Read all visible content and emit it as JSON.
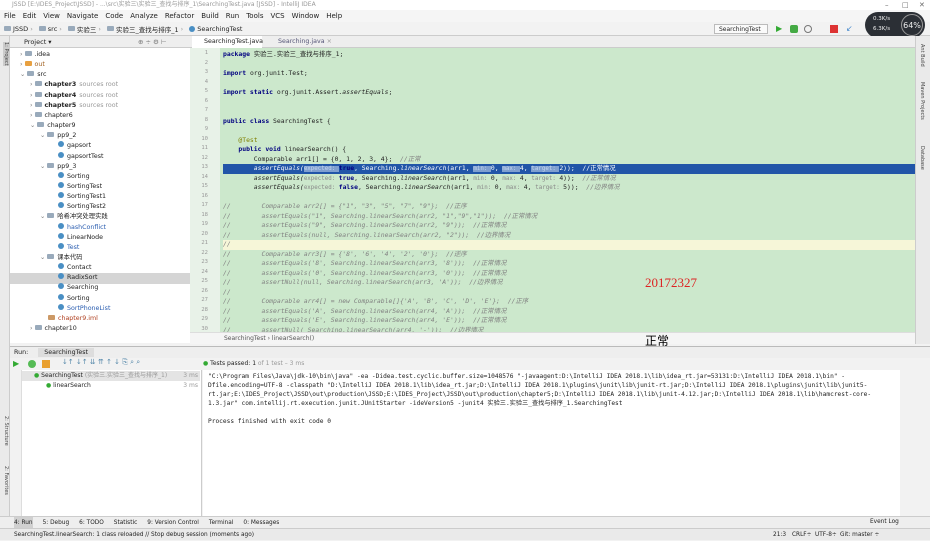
{
  "window": {
    "title": "JSSD [E:\\IDES_Project\\JSSD] - ...\\src\\实验三\\实验三_查找与排序_1\\SearchingTest.java [JSSD] - IntelliJ IDEA"
  },
  "menu": [
    "File",
    "Edit",
    "View",
    "Navigate",
    "Code",
    "Analyze",
    "Refactor",
    "Build",
    "Run",
    "Tools",
    "VCS",
    "Window",
    "Help"
  ],
  "nav": {
    "crumbs": [
      "JSSD",
      "src",
      "实验三",
      "实验三_查找与排序_1",
      "SearchingTest"
    ]
  },
  "toolbar": {
    "run_config": "SearchingTest"
  },
  "perf": {
    "up": "0.3K/s",
    "down": "6.3K/s",
    "percent": "64%"
  },
  "project": {
    "title": "Project ▾",
    "tree": [
      {
        "label": ".idea",
        "depth": 1,
        "kind": "folder",
        "arrow": ">"
      },
      {
        "label": "out",
        "depth": 1,
        "kind": "folder-orange",
        "arrow": ">"
      },
      {
        "label": "src",
        "depth": 1,
        "kind": "folder",
        "arrow": "v"
      },
      {
        "label": "chapter3",
        "depth": 2,
        "kind": "folder",
        "arrow": ">",
        "bold": true,
        "hint": "sources root"
      },
      {
        "label": "chapter4",
        "depth": 2,
        "kind": "folder",
        "arrow": ">",
        "bold": true,
        "hint": "sources root"
      },
      {
        "label": "chapter5",
        "depth": 2,
        "kind": "folder",
        "arrow": ">",
        "bold": true,
        "hint": "sources root"
      },
      {
        "label": "chapter6",
        "depth": 2,
        "kind": "folder",
        "arrow": ">"
      },
      {
        "label": "chapter9",
        "depth": 2,
        "kind": "folder",
        "arrow": "v"
      },
      {
        "label": "pp9_2",
        "depth": 3,
        "kind": "folder",
        "arrow": "v"
      },
      {
        "label": "gapsort",
        "depth": 4,
        "kind": "class"
      },
      {
        "label": "gapsortTest",
        "depth": 4,
        "kind": "class"
      },
      {
        "label": "pp9_3",
        "depth": 3,
        "kind": "folder",
        "arrow": "v"
      },
      {
        "label": "Sorting",
        "depth": 4,
        "kind": "class"
      },
      {
        "label": "SortingTest",
        "depth": 4,
        "kind": "class"
      },
      {
        "label": "SortingTest1",
        "depth": 4,
        "kind": "class"
      },
      {
        "label": "SortingTest2",
        "depth": 4,
        "kind": "class"
      },
      {
        "label": "哈希冲突处理实践",
        "depth": 3,
        "kind": "folder",
        "arrow": "v"
      },
      {
        "label": "hashConflict",
        "depth": 4,
        "kind": "class",
        "blue": true
      },
      {
        "label": "LinearNode",
        "depth": 4,
        "kind": "class"
      },
      {
        "label": "Test",
        "depth": 4,
        "kind": "class",
        "blue": true
      },
      {
        "label": "课本代码",
        "depth": 3,
        "kind": "folder",
        "arrow": "v"
      },
      {
        "label": "Contact",
        "depth": 4,
        "kind": "class"
      },
      {
        "label": "RadixSort",
        "depth": 4,
        "kind": "class",
        "selected": true
      },
      {
        "label": "Searching",
        "depth": 4,
        "kind": "class"
      },
      {
        "label": "Sorting",
        "depth": 4,
        "kind": "class"
      },
      {
        "label": "SortPhoneList",
        "depth": 4,
        "kind": "class",
        "blue": true
      },
      {
        "label": "chapter9.iml",
        "depth": 3,
        "kind": "iml"
      },
      {
        "label": "chapter10",
        "depth": 2,
        "kind": "folder",
        "arrow": ">"
      }
    ]
  },
  "editor": {
    "tabs": [
      {
        "label": "SearchingTest.java",
        "active": true
      },
      {
        "label": "Searching.java",
        "active": false
      }
    ],
    "lines": [
      [
        [
          "package ",
          "kw"
        ],
        [
          "实验三.实验三_查找与排序_1;",
          ""
        ]
      ],
      [],
      [
        [
          "import ",
          "kw"
        ],
        [
          "org.junit.",
          ""
        ],
        [
          "Test",
          ""
        ],
        [
          ";",
          ""
        ]
      ],
      [],
      [
        [
          "import static ",
          "kw"
        ],
        [
          "org.junit.Assert.",
          ""
        ],
        [
          "assertEquals",
          "it"
        ],
        [
          ";",
          ""
        ]
      ],
      [],
      [],
      [
        [
          "public class ",
          "kw"
        ],
        [
          "SearchingTest {",
          ""
        ]
      ],
      [],
      [
        [
          "    @Test",
          "an"
        ]
      ],
      [
        [
          "    public void ",
          "kw"
        ],
        [
          "linearSearch() {",
          ""
        ]
      ],
      [
        [
          "        Comparable arr1[] = {0, 1, 2, 3, 4};  ",
          ""
        ],
        [
          "//正常",
          "cm"
        ]
      ],
      [
        [
          "        assertEquals(",
          "it"
        ],
        [
          "expected: ",
          "hn"
        ],
        [
          "true",
          "kw"
        ],
        [
          ", Searching.",
          ""
        ],
        [
          "linearSearch",
          "it"
        ],
        [
          "(arr1, ",
          ""
        ],
        [
          "min: ",
          "hn"
        ],
        [
          "0, ",
          ""
        ],
        [
          "max: ",
          "hn"
        ],
        [
          "4, ",
          ""
        ],
        [
          "target: ",
          "hn"
        ],
        [
          "2));  //正常情况",
          ""
        ]
      ],
      [
        [
          "        assertEquals(",
          "it"
        ],
        [
          "expected: ",
          "hn"
        ],
        [
          "true",
          "kw"
        ],
        [
          ", Searching.",
          ""
        ],
        [
          "linearSearch",
          "it"
        ],
        [
          "(arr1, ",
          ""
        ],
        [
          "min: ",
          "hn"
        ],
        [
          "0, ",
          ""
        ],
        [
          "max: ",
          "hn"
        ],
        [
          "4, ",
          ""
        ],
        [
          "target: ",
          "hn"
        ],
        [
          "4));  ",
          ""
        ],
        [
          "//正常情况",
          "cm"
        ]
      ],
      [
        [
          "        assertEquals(",
          "it"
        ],
        [
          "expected: ",
          "hn"
        ],
        [
          "false",
          "kw"
        ],
        [
          ", Searching.",
          ""
        ],
        [
          "linearSearch",
          "it"
        ],
        [
          "(arr1, ",
          ""
        ],
        [
          "min: ",
          "hn"
        ],
        [
          "0, ",
          ""
        ],
        [
          "max: ",
          "hn"
        ],
        [
          "4, ",
          ""
        ],
        [
          "target: ",
          "hn"
        ],
        [
          "5));  ",
          ""
        ],
        [
          "//边界情况",
          "cm"
        ]
      ],
      [],
      [
        [
          "//        Comparable arr2[] = {\"1\", \"3\", \"5\", \"7\", \"9\"};  //正序",
          "cm"
        ]
      ],
      [
        [
          "//        assertEquals(\"1\", Searching.linearSearch(arr2, \"1\",\"9\",\"1\"));  //正常情况",
          "cm"
        ]
      ],
      [
        [
          "//        assertEquals(\"9\", Searching.linearSearch(arr2, \"9\"));  //正常情况",
          "cm"
        ]
      ],
      [
        [
          "//        assertEquals(null, Searching.linearSearch(arr2, \"2\"));  //边界情况",
          "cm"
        ]
      ],
      [
        [
          "//",
          "cm"
        ]
      ],
      [
        [
          "//        Comparable arr3[] = {'8', '6', '4', '2', '0'};  //逆序",
          "cm"
        ]
      ],
      [
        [
          "//        assertEquals('8', Searching.linearSearch(arr3, '8'));  //正常情况",
          "cm"
        ]
      ],
      [
        [
          "//        assertEquals('0', Searching.linearSearch(arr3, '0'));  //正常情况",
          "cm"
        ]
      ],
      [
        [
          "//        assertNull(null, Searching.linearSearch(arr3, 'A'));  //边界情况",
          "cm"
        ]
      ],
      [
        [
          "//",
          "cm"
        ]
      ],
      [
        [
          "//        Comparable arr4[] = new Comparable[]{'A', 'B', 'C', 'D', 'E'};  //正序",
          "cm"
        ]
      ],
      [
        [
          "//        assertEquals('A', Searching.linearSearch(arr4, 'A'));  //正常情况",
          "cm"
        ]
      ],
      [
        [
          "//        assertEquals('E', Searching.linearSearch(arr4, 'E'));  //正常情况",
          "cm"
        ]
      ],
      [
        [
          "//        assertNull( Searching.linearSearch(arr4, '-'));  //边界情况",
          "cm"
        ]
      ]
    ],
    "selected_line": 13,
    "caret_line": 21,
    "breadcrumb": "SearchingTest  ›  linearSearch()"
  },
  "right_stripe": [
    "Ant Build",
    "Maven Projects",
    "Database"
  ],
  "overlay": {
    "student_id": "20172327",
    "label": "正常"
  },
  "run": {
    "label": "Run:",
    "tab": "SearchingTest",
    "status_prefix": "Tests passed: ",
    "status_count": "1",
    "status_suffix": " of 1 test – 3 ms",
    "tree": [
      {
        "label": "SearchingTest",
        "hint": "(实验三.实验三_查找与排序_1)",
        "time": "3 ms"
      },
      {
        "label": "linearSearch",
        "time": "3 ms"
      }
    ],
    "console": "\"C:\\Program Files\\Java\\jdk-10\\bin\\java\" -ea -Didea.test.cyclic.buffer.size=1048576 \"-javaagent:D:\\IntelliJ IDEA 2018.1\\lib\\idea_rt.jar=53131:D:\\IntelliJ IDEA 2018.1\\bin\" -Dfile.encoding=UTF-8 -classpath \"D:\\IntelliJ IDEA 2018.1\\lib\\idea_rt.jar;D:\\IntelliJ IDEA 2018.1\\plugins\\junit\\lib\\junit-rt.jar;D:\\IntelliJ IDEA 2018.1\\plugins\\junit\\lib\\junit5-rt.jar;E:\\IDES_Project\\JSSD\\out\\production\\JSSD;E:\\IDES_Project\\JSSD\\out\\production\\chapter5;D:\\IntelliJ IDEA 2018.1\\lib\\junit-4.12.jar;D:\\IntelliJ IDEA 2018.1\\lib\\hamcrest-core-1.3.jar\" com.intellij.rt.execution.junit.JUnitStarter -ideVersion5 -junit4 实验三.实验三_查找与排序_1.SearchingTest",
    "finished": "Process finished with exit code 0"
  },
  "left_stripe": [
    "1: Project",
    "2: Structure",
    "2: Favorites"
  ],
  "bottom_tabs": [
    "4: Run",
    "5: Debug",
    "6: TODO",
    "Statistic",
    "9: Version Control",
    "Terminal",
    "0: Messages"
  ],
  "event_log": "Event Log",
  "status": {
    "message": "SearchingTest.linearSearch: 1 class reloaded // Stop debug session (moments ago)",
    "position": "21:3",
    "line_sep": "CRLF÷",
    "encoding": "UTF-8÷",
    "git": "Git: master ÷"
  }
}
